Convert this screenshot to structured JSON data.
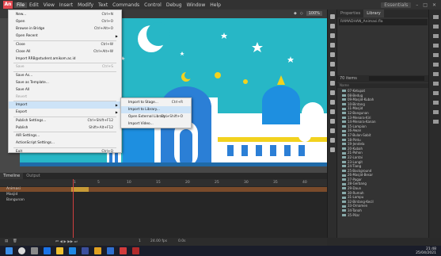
{
  "menubar": {
    "logo": "An",
    "items": [
      "File",
      "Edit",
      "View",
      "Insert",
      "Modify",
      "Text",
      "Commands",
      "Control",
      "Debug",
      "Window",
      "Help"
    ],
    "workspace": "Essentials"
  },
  "stage": {
    "zoom": "100%"
  },
  "file_menu": {
    "items": [
      {
        "label": "New...",
        "shortcut": "Ctrl+N",
        "disabled": false
      },
      {
        "label": "Open",
        "shortcut": "Ctrl+O",
        "disabled": false
      },
      {
        "label": "Browse in Bridge",
        "shortcut": "Ctrl+Alt+O",
        "disabled": false
      },
      {
        "label": "Open Recent",
        "shortcut": "",
        "disabled": false,
        "submenu": true
      },
      {
        "label": "Close",
        "shortcut": "Ctrl+W",
        "disabled": false
      },
      {
        "label": "Close All",
        "shortcut": "Ctrl+Alt+W",
        "disabled": false
      },
      {
        "label": "Import RRB@student.amikom.ac.id",
        "shortcut": "",
        "disabled": false
      },
      {
        "label": "Save",
        "shortcut": "Ctrl+S",
        "disabled": true
      },
      {
        "label": "Save As...",
        "shortcut": "",
        "disabled": false
      },
      {
        "label": "Save as Template...",
        "shortcut": "",
        "disabled": false
      },
      {
        "label": "Save All",
        "shortcut": "",
        "disabled": false
      },
      {
        "label": "Revert",
        "shortcut": "",
        "disabled": true
      },
      {
        "label": "Import",
        "shortcut": "",
        "disabled": false,
        "submenu": true,
        "highlight": true
      },
      {
        "label": "Export",
        "shortcut": "",
        "disabled": false,
        "submenu": true
      },
      {
        "label": "Publish Settings...",
        "shortcut": "Ctrl+Shift+F12",
        "disabled": false
      },
      {
        "label": "Publish",
        "shortcut": "Shift+Alt+F12",
        "disabled": false
      },
      {
        "label": "AIR Settings...",
        "shortcut": "",
        "disabled": false
      },
      {
        "label": "ActionScript Settings...",
        "shortcut": "",
        "disabled": false
      },
      {
        "label": "Exit",
        "shortcut": "Ctrl+Q",
        "disabled": false
      }
    ]
  },
  "import_submenu": {
    "items": [
      {
        "label": "Import to Stage...",
        "shortcut": "Ctrl+R"
      },
      {
        "label": "Import to Library...",
        "shortcut": "",
        "highlight": true
      },
      {
        "label": "Open External Library...",
        "shortcut": "Ctrl+Shift+O"
      },
      {
        "label": "Import Video...",
        "shortcut": ""
      }
    ]
  },
  "right_panel": {
    "tabs": [
      "Properties",
      "Library"
    ],
    "document": "RAMADHAN_Animasi.fla",
    "library_count": "70 items",
    "library_items": [
      "07-Ketupat",
      "08-Bedug",
      "09-Masjid-Kubah",
      "10-Bintang",
      "11-Masjid",
      "12-Bangunan",
      "13-Menara-Kiri",
      "14-Menara-Kanan",
      "15-Lampion",
      "16-Awan",
      "17-Bulan-Sabit",
      "18-Pintu",
      "19-Jendela",
      "20-Kubah",
      "21-Pohon",
      "22-Lantai",
      "23-Langit",
      "24-Tiang",
      "25-Background",
      "26-Masjid-Besar",
      "27-Pagar",
      "28-Gerbang",
      "29-Daun",
      "30-Rumah",
      "31-Lampu",
      "32-Bintang-Kecil",
      "33-Ornamen",
      "34-Tanah",
      "35-Pilar"
    ]
  },
  "timeline": {
    "tabs": [
      "Timeline",
      "Output"
    ],
    "ruler": [
      "1",
      "5",
      "10",
      "15",
      "20",
      "25",
      "30",
      "35",
      "40"
    ],
    "layers": [
      {
        "name": "Animasi",
        "selected": true
      },
      {
        "name": "Masjid",
        "selected": false
      },
      {
        "name": "Bangunan",
        "selected": false
      }
    ],
    "fps": "24.00 fps",
    "time": "0.0s",
    "frame": "1"
  },
  "taskbar": {
    "time": "21:48",
    "date": "25/04/2021"
  },
  "colors": {
    "sky": "#27b7c6",
    "mosque_blue": "#2b7fd6",
    "gold": "#f2d21e",
    "menu_bg": "#f2f2f2",
    "highlight": "#cde3f7"
  }
}
